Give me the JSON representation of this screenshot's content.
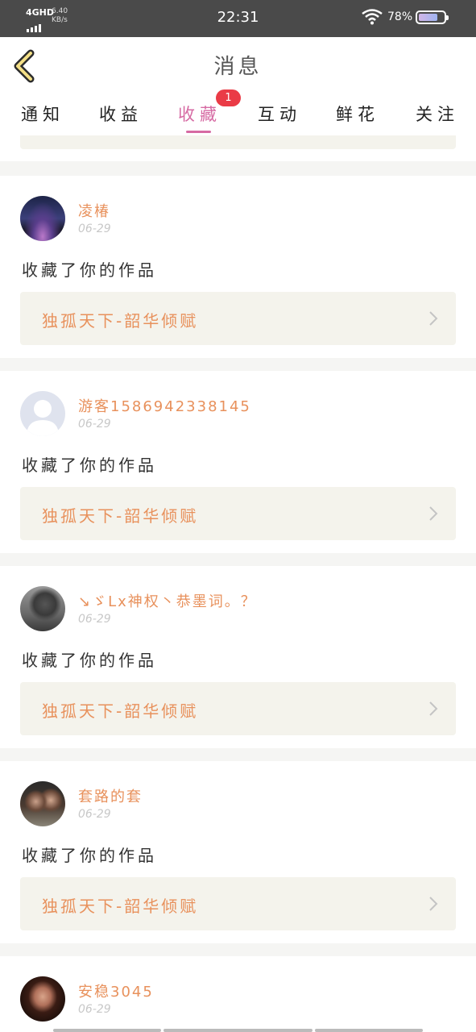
{
  "status_bar": {
    "network": "4GHD",
    "speed_value": "6.40",
    "speed_unit": "KB/s",
    "time": "22:31",
    "battery_text": "78%",
    "battery_level": 0.78
  },
  "header": {
    "title": "消息"
  },
  "tabs": [
    {
      "label": "通知"
    },
    {
      "label": "收益"
    },
    {
      "label": "收藏",
      "active": true,
      "badge": "1"
    },
    {
      "label": "互动"
    },
    {
      "label": "鲜花"
    },
    {
      "label": "关注"
    }
  ],
  "items": [
    {
      "username": "凌椿",
      "date": "06-29",
      "action": "收藏了你的作品",
      "work_title": "独孤天下-韶华倾赋",
      "avatar": "aurora-avatar"
    },
    {
      "username": "游客15869423381​45",
      "date": "06-29",
      "action": "收藏了你的作品",
      "work_title": "独孤天下-韶华倾赋",
      "avatar": "default-avatar"
    },
    {
      "username": "↘ゞLx神权丶恭墨词。？",
      "date": "06-29",
      "action": "收藏了你的作品",
      "work_title": "独孤天下-韶华倾赋",
      "avatar": "photo-avatar"
    },
    {
      "username": "套路的套",
      "date": "06-29",
      "action": "收藏了你的作品",
      "work_title": "独孤天下-韶华倾赋",
      "avatar": "couple-avatar"
    },
    {
      "username": "安稳3045",
      "date": "06-29",
      "action": "",
      "work_title": "",
      "avatar": "portrait-avatar"
    }
  ],
  "colors": {
    "accent": "#d66aa3",
    "username": "#e8915c",
    "badge": "#ea3b46"
  }
}
